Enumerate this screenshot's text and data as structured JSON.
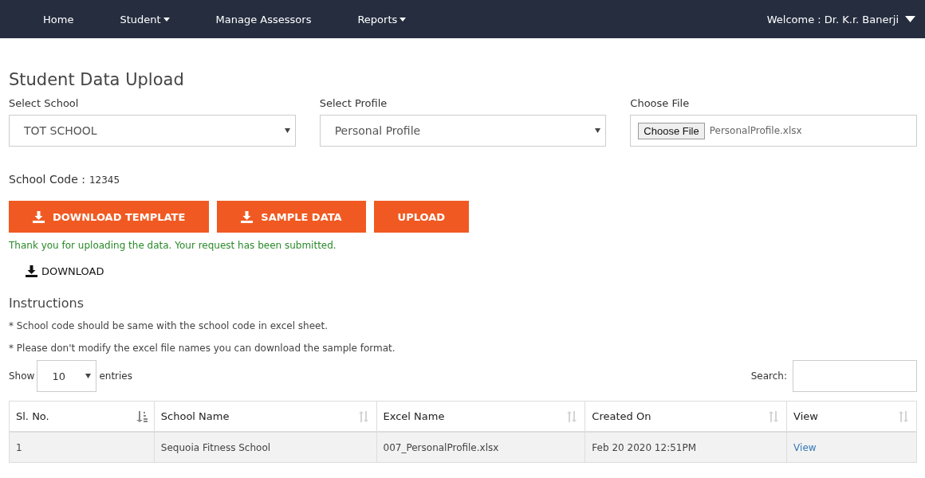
{
  "nav": {
    "items": [
      {
        "label": "Home",
        "dropdown": false
      },
      {
        "label": "Student",
        "dropdown": true
      },
      {
        "label": "Manage Assessors",
        "dropdown": false
      },
      {
        "label": "Reports",
        "dropdown": true
      }
    ],
    "user": "Welcome : Dr. K.r. Banerji"
  },
  "title": "Student Data Upload",
  "fields": [
    {
      "kind": "select",
      "label": "Select School",
      "value": "TOT SCHOOL"
    },
    {
      "kind": "select",
      "label": "Select Profile",
      "value": "Personal Profile"
    },
    {
      "kind": "file",
      "label": "Choose File",
      "button": "Choose File",
      "value": "PersonalProfile.xlsx"
    }
  ],
  "school_code": {
    "label": "School Code :",
    "value": "12345"
  },
  "buttons": [
    {
      "label": "DOWNLOAD TEMPLATE",
      "icon": true
    },
    {
      "label": "SAMPLE DATA",
      "icon": true
    },
    {
      "label": "UPLOAD",
      "icon": false
    }
  ],
  "message": "Thank you for uploading the data. Your request has been submitted.",
  "download_link": "DOWNLOAD",
  "instructions": {
    "heading": "Instructions",
    "lines": [
      "* School code should be same with the school code in excel sheet.",
      "* Please don't modify the excel file names you can download the sample format."
    ]
  },
  "table_controls": {
    "show_label": "Show",
    "entries_value": "10",
    "entries_label": "entries",
    "search_label": "Search:"
  },
  "table": {
    "columns": [
      {
        "label": "Sl. No.",
        "sorted": true
      },
      {
        "label": "School Name",
        "sorted": false
      },
      {
        "label": "Excel Name",
        "sorted": false
      },
      {
        "label": "Created On",
        "sorted": false
      },
      {
        "label": "View",
        "sorted": false
      }
    ],
    "rows": [
      [
        "1",
        "Sequoia Fitness School",
        "007_PersonalProfile.xlsx",
        "Feb 20 2020 12:51PM",
        "View"
      ]
    ]
  }
}
